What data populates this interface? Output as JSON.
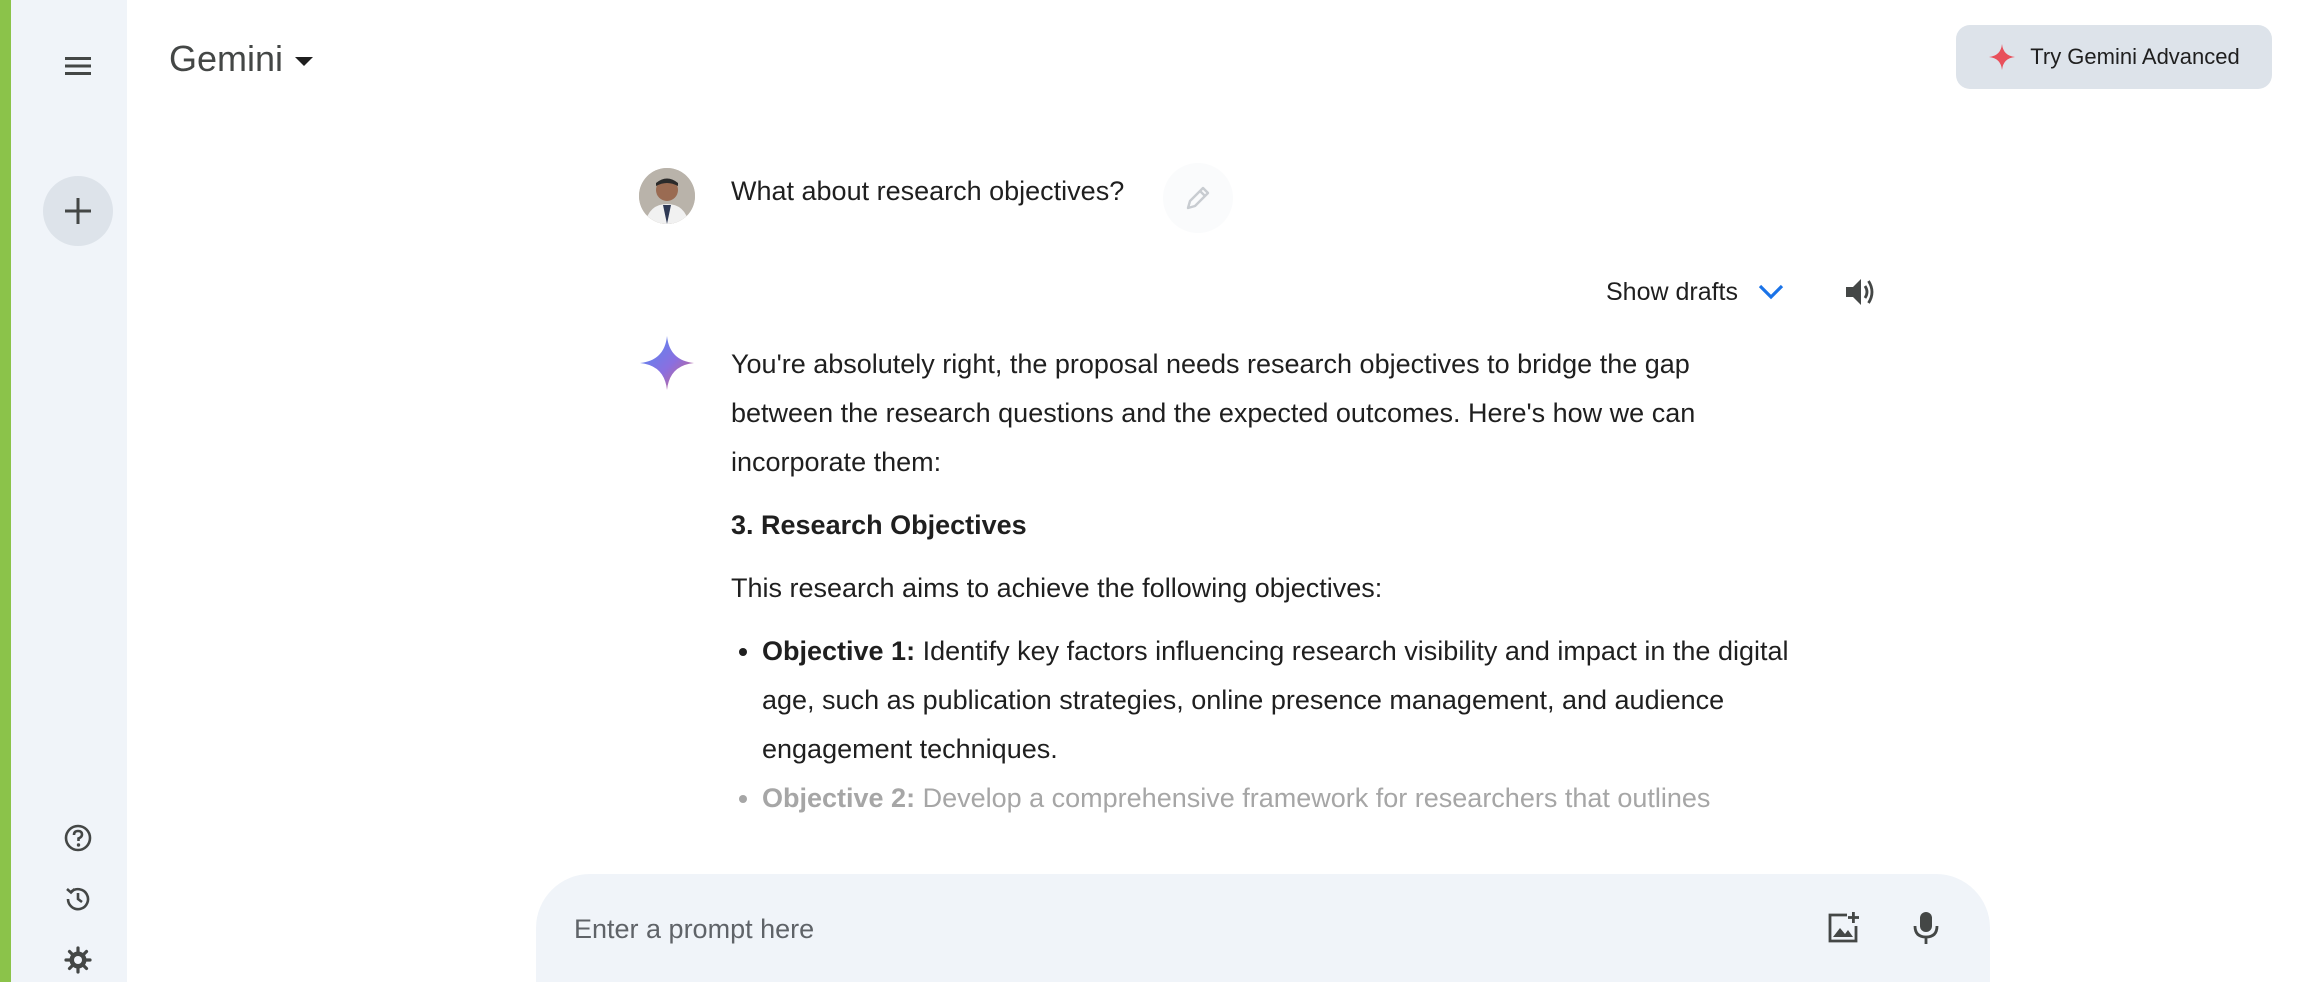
{
  "sidebar": {
    "menu_icon": "menu-icon",
    "new_chat_icon": "plus-icon",
    "help_icon": "help-icon",
    "activity_icon": "history-icon",
    "settings_icon": "gear-icon"
  },
  "header": {
    "brand": "Gemini",
    "try_advanced_label": "Try Gemini Advanced",
    "accent": "#e8505b"
  },
  "conversation": {
    "user_query": "What about research objectives?",
    "show_drafts_label": "Show drafts",
    "response": {
      "intro": "You're absolutely right, the proposal needs research objectives to bridge the gap between the research questions and the expected outcomes. Here's how we can incorporate them:",
      "heading": "3. Research Objectives",
      "aim": "This research aims to achieve the following objectives:",
      "objectives": [
        {
          "label": "Objective 1:",
          "text": " Identify key factors influencing research visibility and impact in the digital age, such as publication strategies, online presence management, and audience engagement techniques."
        },
        {
          "label": "Objective 2:",
          "text": " Develop a comprehensive framework for researchers that outlines"
        }
      ]
    }
  },
  "prompt": {
    "placeholder": "Enter a prompt here"
  },
  "colors": {
    "sidebar_bg": "#f0f4f9",
    "green_edge": "#8bc34a",
    "link_blue": "#1a73e8"
  }
}
